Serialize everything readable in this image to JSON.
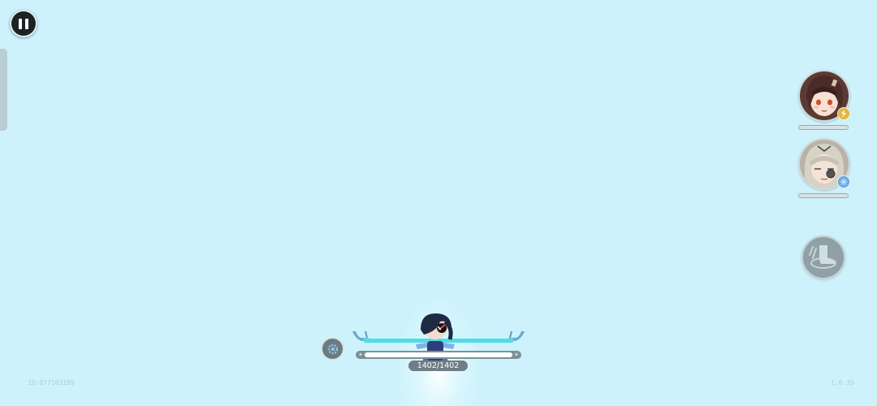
{
  "hud": {
    "pause_icon": "pause-icon"
  },
  "team": [
    {
      "name": "",
      "portrait_icon": "brown-hair-girl-portrait",
      "element_icon": "lightning-icon",
      "element_color": "#e5b53d",
      "bar_color": "#d8e2e5"
    },
    {
      "name": "",
      "portrait_icon": "white-hair-girl-portrait",
      "element_icon": "ice-icon",
      "element_color": "#5ea6e3",
      "bar_color": "#d8e2e5"
    }
  ],
  "skill_button": {
    "icon": "dash-boot-icon"
  },
  "player": {
    "hp_current": 1402,
    "hp_max": 1402,
    "hp_text": "1402/1402",
    "shield_color": "#52dbe6",
    "skill_icon": "gear-icon"
  },
  "footer": {
    "user_id": "ID:877103189",
    "version": "1.0.35"
  }
}
